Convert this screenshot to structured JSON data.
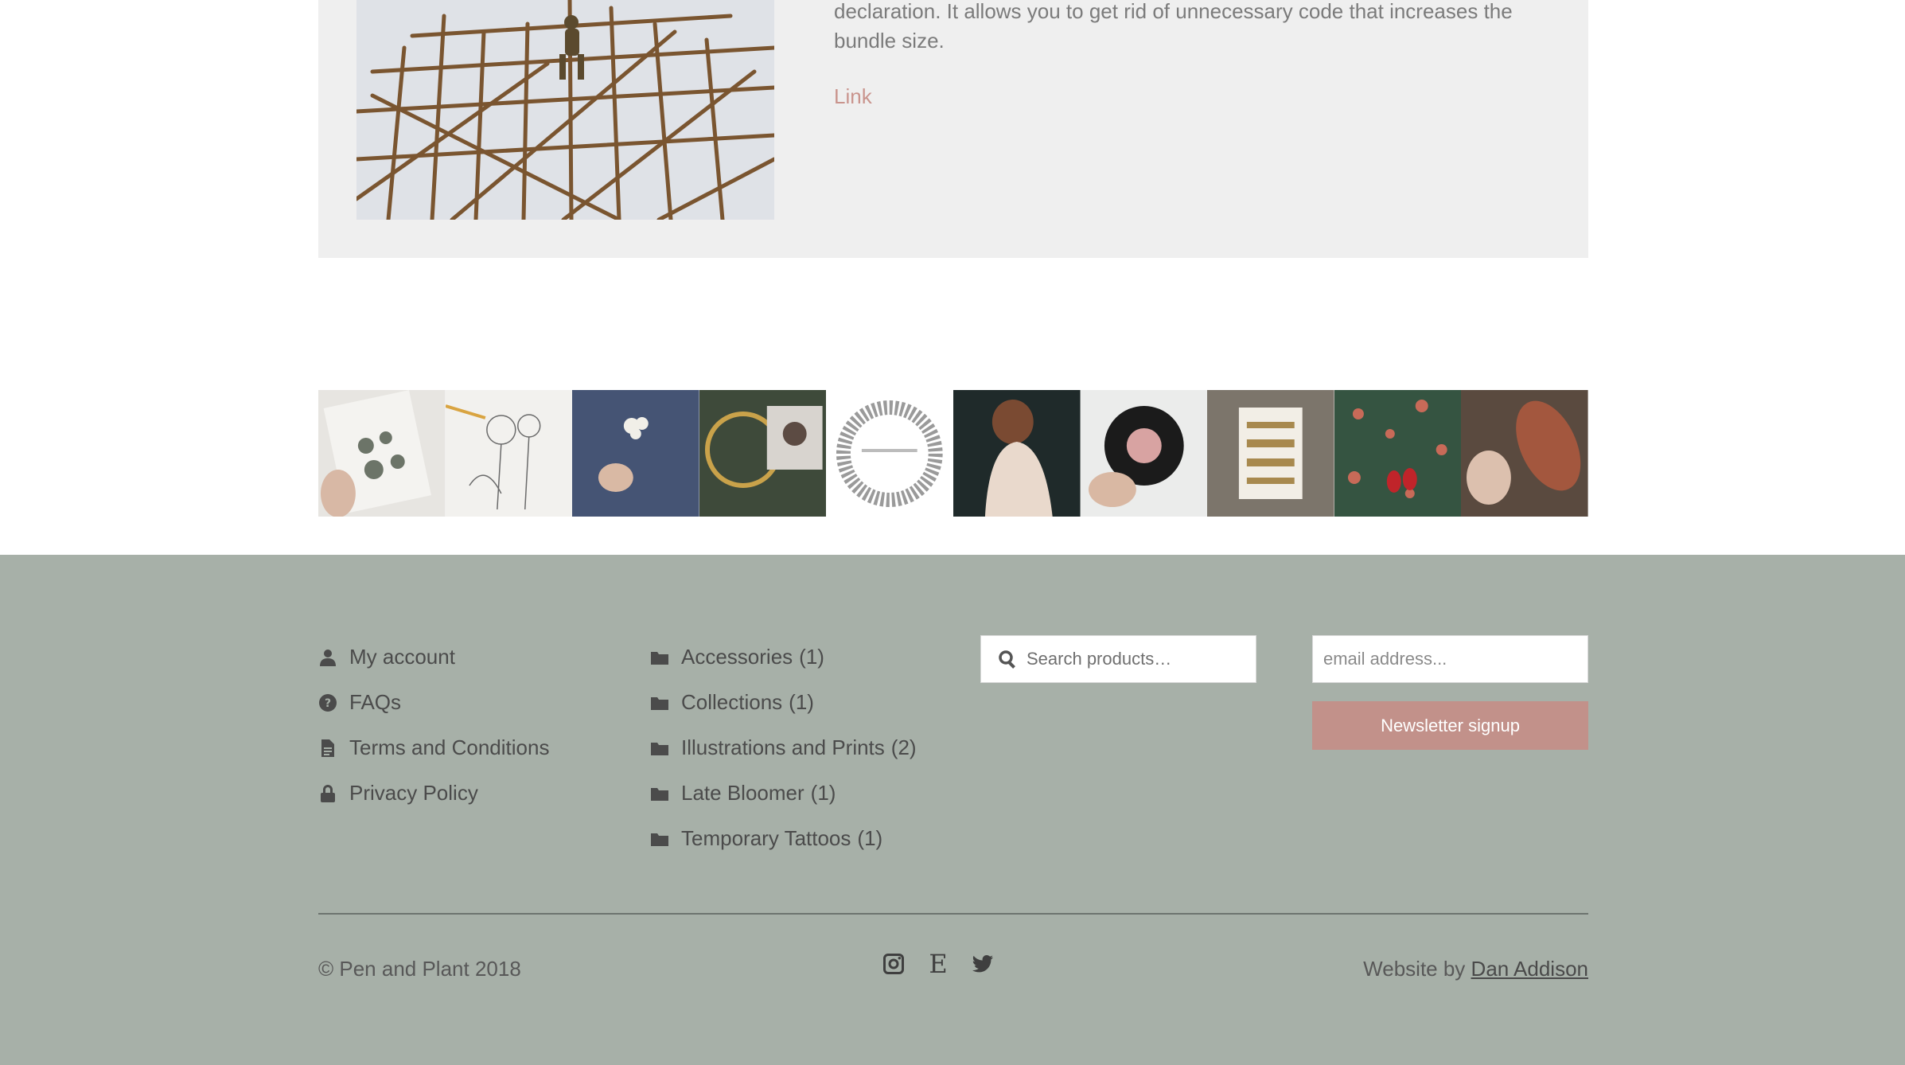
{
  "card": {
    "text": "declaration. It allows you to get rid of unnecessary code that increases the bundle size.",
    "link_label": "Link"
  },
  "instagram": {
    "tiles": [
      "fern-tattoo-sheets",
      "pencil-flower-drawing",
      "flower-on-denim",
      "brass-hoops-portrait",
      "nature-girl-silver-wreath",
      "woman-back-portrait",
      "late-bloomer-sticker",
      "fern-print-card",
      "red-shoes-leaves",
      "autumn-leaf-hand"
    ]
  },
  "footer": {
    "account_menu": [
      {
        "label": "My account",
        "icon": "user-icon"
      },
      {
        "label": "FAQs",
        "icon": "question-circle-icon"
      },
      {
        "label": "Terms and Conditions",
        "icon": "document-icon"
      },
      {
        "label": "Privacy Policy",
        "icon": "lock-icon"
      }
    ],
    "categories": [
      {
        "label": "Accessories",
        "count": "(1)"
      },
      {
        "label": "Collections",
        "count": "(1)"
      },
      {
        "label": "Illustrations and Prints",
        "count": "(2)"
      },
      {
        "label": "Late Bloomer",
        "count": "(1)"
      },
      {
        "label": "Temporary Tattoos",
        "count": "(1)"
      }
    ],
    "search": {
      "placeholder": "Search products…"
    },
    "newsletter": {
      "placeholder": "email address...",
      "button_label": "Newsletter signup"
    },
    "copyright": "© Pen and Plant 2018",
    "social_icons": [
      "instagram-icon",
      "etsy-icon",
      "twitter-icon"
    ],
    "etsy_glyph": "E",
    "credit_prefix": "Website by",
    "credit_name": "Dan Addison"
  },
  "colors": {
    "footer_bg": "#a7b0a8",
    "card_bg": "#efefef",
    "accent": "#c2918a",
    "link": "#c9948d"
  }
}
